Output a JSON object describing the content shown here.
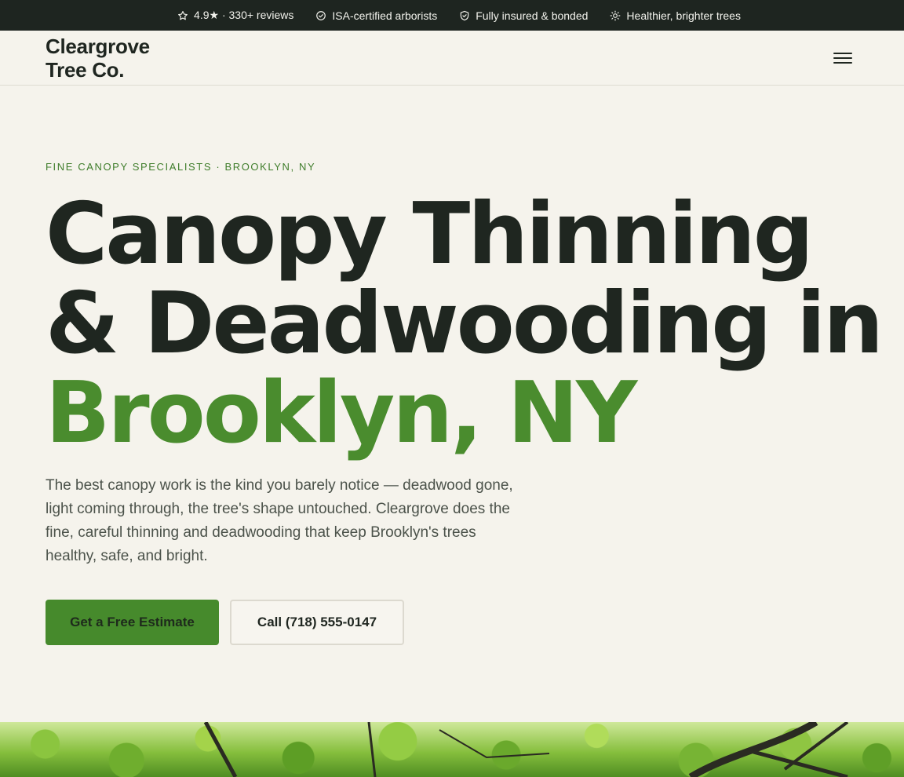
{
  "topbar": {
    "items": [
      {
        "icon": "star-icon",
        "label": "4.9★ · 330+ reviews"
      },
      {
        "icon": "check-circle-icon",
        "label": "ISA-certified arborists"
      },
      {
        "icon": "shield-icon",
        "label": "Fully insured & bonded"
      },
      {
        "icon": "sun-icon",
        "label": "Healthier, brighter trees"
      }
    ]
  },
  "nav": {
    "logo": "Cleargrove\nTree Co.",
    "menu_icon": "hamburger-menu-icon"
  },
  "hero": {
    "eyebrow": "FINE CANOPY SPECIALISTS · BROOKLYN, NY",
    "headline": {
      "line1": "Canopy Thinning",
      "line2": "& Deadwooding in",
      "accent": "Brooklyn, NY"
    },
    "lede": "The best canopy work is the kind you barely notice — deadwood gone, light coming through, the tree's shape untouched. Cleargrove does the fine, careful thinning and deadwooding that keep Brooklyn's trees healthy, safe, and bright.",
    "primary_cta": "Get a Free Estimate",
    "secondary_cta": "Call (718) 555-0147"
  },
  "colors": {
    "topbar_bg": "#1e2520",
    "page_bg": "#f5f3ec",
    "accent_green": "#4a8c2e",
    "text_dark": "#1f2620"
  }
}
